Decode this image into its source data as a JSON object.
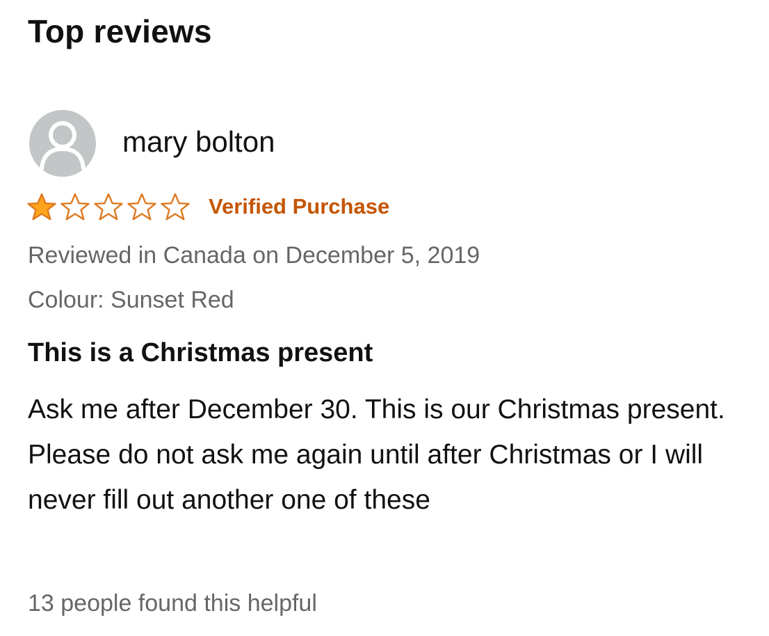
{
  "section": {
    "title": "Top reviews"
  },
  "review": {
    "reviewer_name": "mary bolton",
    "avatar_icon": "user-silhouette-icon",
    "rating": 1,
    "rating_max": 5,
    "star_color": "#ffa41c",
    "star_outline_color": "#de7921",
    "verified_label": "Verified Purchase",
    "verified_color": "#c45500",
    "date_text": "Reviewed in Canada on December 5, 2019",
    "variant_text": "Colour: Sunset Red",
    "title": "This is a Christmas present",
    "body": "Ask me after December 30. This is our Christmas present. Please do not ask me again until after Christmas or I will never fill out another one of these",
    "helpful_text": "13 people found this helpful"
  }
}
